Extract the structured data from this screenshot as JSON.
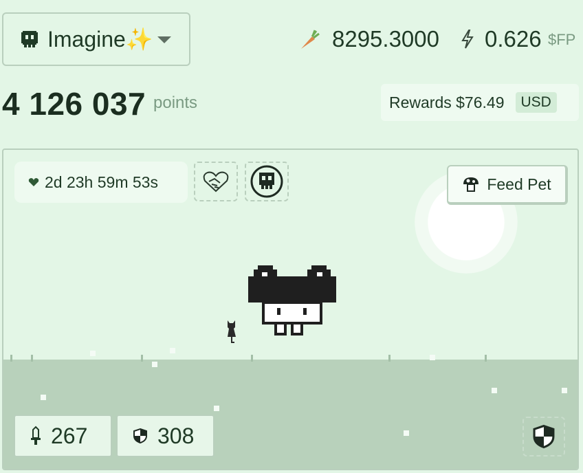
{
  "pet": {
    "name": "Imagine✨",
    "icon": "pixel-ghost-icon"
  },
  "balances": {
    "carrots": "8295.3000",
    "fp": "0.626",
    "fp_unit": "$FP",
    "carrot_icon": "carrot-icon",
    "fp_icon": "lightning-bolt-icon"
  },
  "points": {
    "value": "4 126 037",
    "unit": "points"
  },
  "rewards": {
    "label": "Rewards $76.49",
    "currency": "USD"
  },
  "scene": {
    "timer": "2d 23h 59m 53s",
    "feed_label": "Feed Pet",
    "attack": "267",
    "defense": "308"
  },
  "colors": {
    "background": "#e3f6e6",
    "ground": "#b8d1bb",
    "border": "#b9cfbd",
    "text": "#1f3a26",
    "muted": "#7a9a82"
  }
}
